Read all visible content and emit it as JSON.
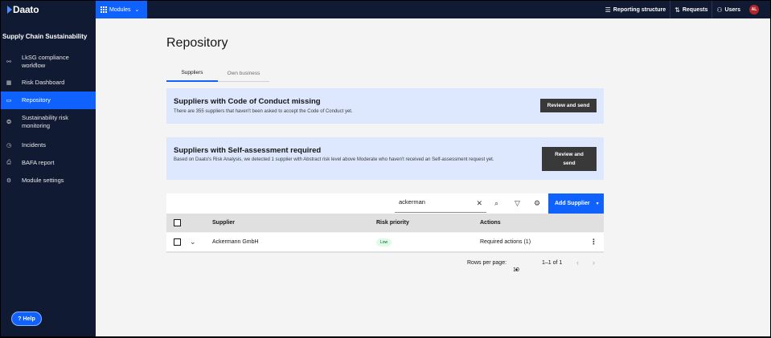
{
  "header": {
    "logo": "Daato",
    "modules_label": "Modules",
    "reporting_label": "Reporting structure",
    "requests_label": "Requests",
    "users_label": "Users",
    "avatar_initials": "AL"
  },
  "sidebar": {
    "title": "Supply Chain Sustainability",
    "items": [
      {
        "label": "LkSG compliance workflow",
        "icon": "workflow-icon"
      },
      {
        "label": "Risk Dashboard",
        "icon": "dashboard-icon"
      },
      {
        "label": "Repository",
        "icon": "repository-icon",
        "active": true
      },
      {
        "label": "Sustainability risk monitoring",
        "icon": "monitoring-icon"
      },
      {
        "label": "Incidents",
        "icon": "incidents-icon"
      },
      {
        "label": "BAFA report",
        "icon": "report-icon"
      },
      {
        "label": "Module settings",
        "icon": "settings-icon"
      }
    ],
    "help_label": "Help"
  },
  "main": {
    "title": "Repository",
    "tabs": [
      {
        "label": "Suppliers",
        "active": true
      },
      {
        "label": "Own business",
        "active": false
      }
    ],
    "banners": [
      {
        "title": "Suppliers with Code of Conduct missing",
        "text": "There are 355 suppliers that haven't been asked to accept the Code of Conduct yet.",
        "button": "Review and send"
      },
      {
        "title": "Suppliers with Self-assessment required",
        "text": "Based on Daato's Risk Analysis, we detected 1 supplier with Abstract risk level above Moderate who haven't received an Self-assessment request yet.",
        "button": "Review and send"
      }
    ],
    "search": {
      "value": "ackerman"
    },
    "add_supplier_label": "Add Supplier",
    "table": {
      "columns": [
        "Supplier",
        "Risk priority",
        "Actions"
      ],
      "rows": [
        {
          "supplier": "Ackermann GmbH",
          "risk": "Low",
          "actions": "Required actions (1)"
        }
      ]
    },
    "pagination": {
      "rows_per_page_label": "Rows per page:",
      "rows_per_page": "10",
      "range": "1–1 of 1"
    }
  },
  "colors": {
    "nav_bg": "#101a33",
    "accent": "#0f62fe",
    "banner_bg": "#dde8ff",
    "button_dark": "#393939",
    "badge_low_bg": "#defbe6"
  }
}
